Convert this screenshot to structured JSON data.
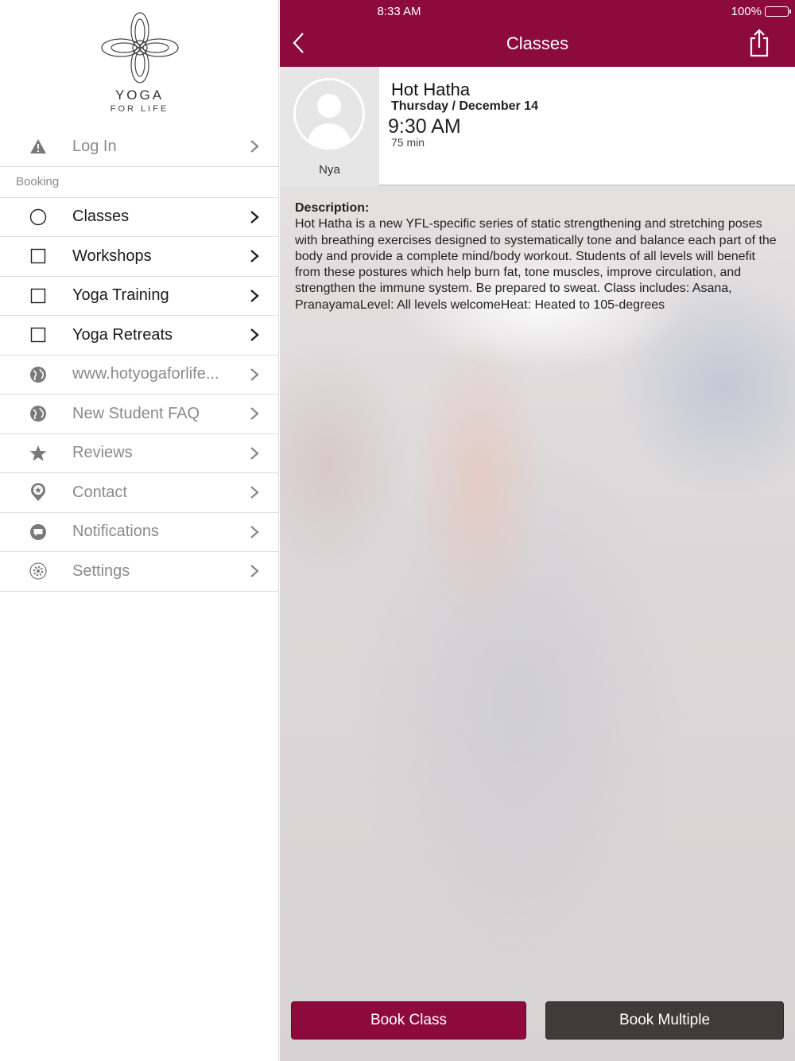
{
  "app": {
    "logo_title": "YOGA",
    "logo_sub": "FOR LIFE"
  },
  "status_bar": {
    "time": "8:33 AM",
    "battery": "100%"
  },
  "nav": {
    "title": "Classes"
  },
  "sidebar": {
    "login": {
      "label": "Log In",
      "icon": "warning-icon"
    },
    "section_booking": "Booking",
    "items": [
      {
        "label": "Classes",
        "icon": "circle-icon",
        "style": "strong"
      },
      {
        "label": "Workshops",
        "icon": "square-icon",
        "style": "strong"
      },
      {
        "label": "Yoga Training",
        "icon": "square-icon",
        "style": "strong"
      },
      {
        "label": "Yoga Retreats",
        "icon": "square-icon",
        "style": "strong"
      },
      {
        "label": "www.hotyogaforlife...",
        "icon": "globe-icon",
        "style": "dim"
      },
      {
        "label": "New Student FAQ",
        "icon": "globe-icon",
        "style": "dim"
      },
      {
        "label": "Reviews",
        "icon": "star-icon",
        "style": "dim"
      },
      {
        "label": "Contact",
        "icon": "location-pin-icon",
        "style": "dim"
      },
      {
        "label": "Notifications",
        "icon": "chat-bubble-icon",
        "style": "dim"
      },
      {
        "label": "Settings",
        "icon": "gear-icon",
        "style": "dim"
      }
    ]
  },
  "class_detail": {
    "instructor": "Nya",
    "name": "Hot Hatha",
    "date": "Thursday / December 14",
    "time": "9:30 AM",
    "duration": "75 min",
    "description_label": "Description:",
    "description": "Hot Hatha is a new YFL-specific series of static strengthening and stretching poses with breathing exercises designed to systematically tone and balance each part of the body and provide a complete mind/body workout. Students of all levels will benefit from these postures which help burn fat, tone muscles, improve circulation, and strengthen the immune system. Be prepared to sweat. Class includes: Asana, PranayamaLevel: All levels welcomeHeat: Heated to 105-degrees"
  },
  "buttons": {
    "book_class": "Book Class",
    "book_multiple": "Book Multiple"
  },
  "colors": {
    "accent": "#8d0a3d",
    "secondary_button": "#3f3b3a"
  }
}
